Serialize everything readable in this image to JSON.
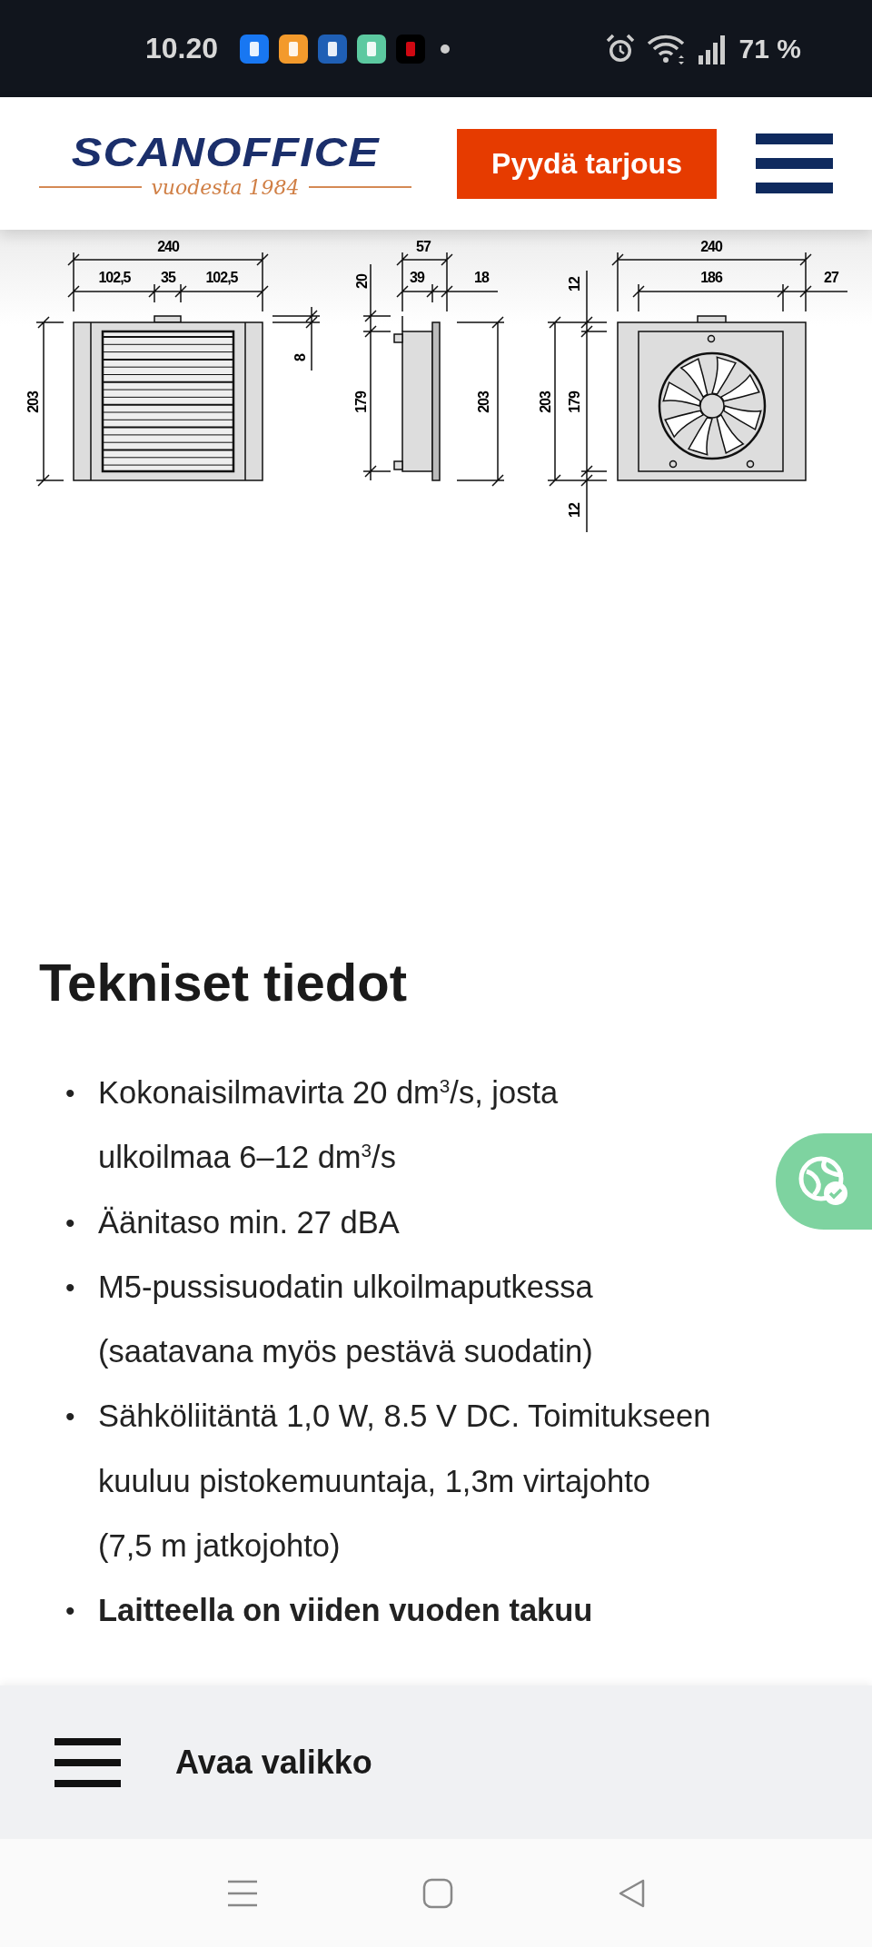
{
  "status_bar": {
    "time": "10.20",
    "battery": "71 %"
  },
  "header": {
    "logo_name": "SCANOFFICE",
    "logo_tagline": "vuodesta 1984",
    "cta": "Pyydä tarjous"
  },
  "diagram": {
    "front_view": [
      "240",
      "102,5",
      "35",
      "102,5",
      "203",
      "8"
    ],
    "side_view": [
      "57",
      "39",
      "18",
      "20",
      "179",
      "203"
    ],
    "back_view": [
      "240",
      "186",
      "27",
      "12",
      "203",
      "179",
      "12"
    ]
  },
  "section_title": "Tekniset tiedot",
  "specs": [
    {
      "marker": "•",
      "lines": [
        "Kokonaisilmavirta 20 dm$^{3}$/s, josta",
        "ulkoilmaa 6–12 dm$^{3}$/s"
      ],
      "bold": false
    },
    {
      "marker": "•",
      "lines": [
        "Äänitaso min. 27 dBA"
      ],
      "bold": false
    },
    {
      "marker": "•",
      "lines": [
        "M5-pussisuodatin ulkoilmaputkessa",
        "(saatavana myös pestävä suodatin)"
      ],
      "bold": false
    },
    {
      "marker": "•",
      "lines": [
        "Sähköliitäntä 1,0 W, 8.5 V DC. Toimitukseen",
        "kuuluu pistokemuuntaja, 1,3m virtajohto",
        "(7,5 m jatkojohto)"
      ],
      "bold": false
    },
    {
      "marker": "•",
      "lines": [
        "Laitteella on viiden vuoden takuu"
      ],
      "bold": true
    }
  ],
  "bottom_bar": {
    "label": "Avaa valikko"
  }
}
